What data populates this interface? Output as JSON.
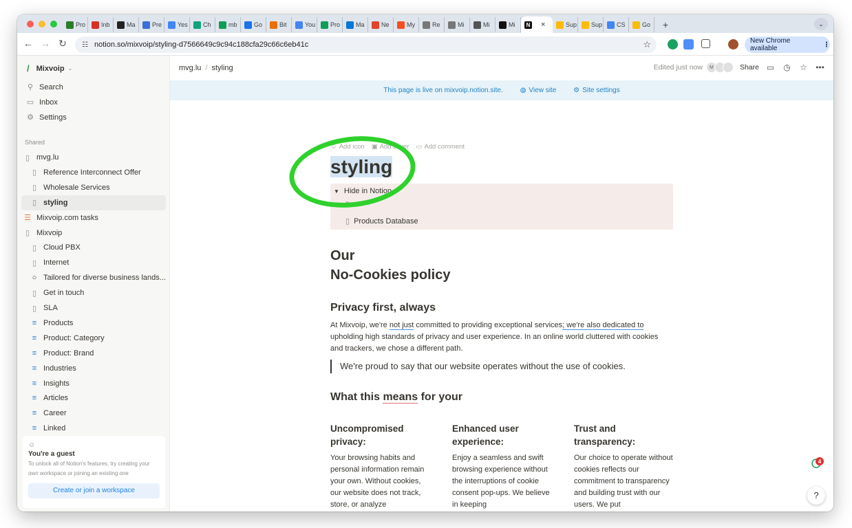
{
  "browser": {
    "tabs": [
      {
        "label": "Pro",
        "color": "#2a7d2a"
      },
      {
        "label": "Inb",
        "color": "#d93025"
      },
      {
        "label": "Ma",
        "color": "#222222"
      },
      {
        "label": "Pre",
        "color": "#3a6ed8"
      },
      {
        "label": "Yes",
        "color": "#4285f4"
      },
      {
        "label": "Ch",
        "color": "#10a37f"
      },
      {
        "label": "mb",
        "color": "#0f9d58"
      },
      {
        "label": "Go",
        "color": "#1a73e8"
      },
      {
        "label": "Bit",
        "color": "#e8710a"
      },
      {
        "label": "You",
        "color": "#4285f4"
      },
      {
        "label": "Pro",
        "color": "#0f9d58"
      },
      {
        "label": "Ma",
        "color": "#0078d4"
      },
      {
        "label": "Ne",
        "color": "#e24329"
      },
      {
        "label": "My",
        "color": "#f25022"
      },
      {
        "label": "Re",
        "color": "#777777"
      },
      {
        "label": "Mi",
        "color": "#777777"
      },
      {
        "label": "Mi",
        "color": "#555555"
      },
      {
        "label": "Mi",
        "color": "#111111"
      }
    ],
    "active_tab_close": "×",
    "tabs_after": [
      {
        "label": "Sup",
        "color": "#fbbc04"
      },
      {
        "label": "Sup",
        "color": "#fbbc04"
      },
      {
        "label": "CS",
        "color": "#4285f4"
      },
      {
        "label": "Go",
        "color": "#fbbc04"
      }
    ],
    "new_tab": "+",
    "url": "notion.so/mixvoip/styling-d7566649c9c94c188cfa29c66c6eb41c",
    "new_chrome": "New Chrome available"
  },
  "sidebar": {
    "workspace": "Mixvoip",
    "nav": [
      {
        "icon": "search-icon",
        "glyph": "⚲",
        "label": "Search"
      },
      {
        "icon": "inbox-icon",
        "glyph": "▭",
        "label": "Inbox"
      },
      {
        "icon": "gear-icon",
        "glyph": "⚙",
        "label": "Settings"
      }
    ],
    "shared_label": "Shared",
    "items": [
      {
        "label": "mvg.lu",
        "icon": "page-icon",
        "indent": false
      },
      {
        "label": "Reference Interconnect Offer",
        "icon": "page-icon",
        "indent": true
      },
      {
        "label": "Wholesale Services",
        "icon": "page-icon",
        "indent": true
      },
      {
        "label": "styling",
        "icon": "page-icon",
        "indent": true,
        "selected": true
      },
      {
        "label": "Mixvoip.com tasks",
        "icon": "checklist-icon",
        "indent": false
      },
      {
        "label": "Mixvoip",
        "icon": "page-icon",
        "indent": false
      },
      {
        "label": "Cloud PBX",
        "icon": "page-icon",
        "indent": true
      },
      {
        "label": "Internet",
        "icon": "page-icon",
        "indent": true
      },
      {
        "label": "Tailored for diverse business lands...",
        "icon": "circle-icon",
        "indent": true
      },
      {
        "label": "Get in touch",
        "icon": "page-icon",
        "indent": true
      },
      {
        "label": "SLA",
        "icon": "page-icon",
        "indent": true
      },
      {
        "label": "Products",
        "icon": "database-icon",
        "indent": true
      },
      {
        "label": "Product: Category",
        "icon": "database-icon",
        "indent": true
      },
      {
        "label": "Product: Brand",
        "icon": "database-icon",
        "indent": true
      },
      {
        "label": "Industries",
        "icon": "database-icon",
        "indent": true
      },
      {
        "label": "Insights",
        "icon": "database-icon",
        "indent": true
      },
      {
        "label": "Articles",
        "icon": "database-icon",
        "indent": true
      },
      {
        "label": "Career",
        "icon": "database-icon",
        "indent": true
      },
      {
        "label": "Linked",
        "icon": "database-icon",
        "indent": true
      }
    ],
    "guest": {
      "title": "You're a guest",
      "subtitle": "To unlock all of Notion's features, try creating your own workspace or joining an existing one",
      "button": "Create or join a workspace"
    }
  },
  "topbar": {
    "breadcrumb": [
      "mvg.lu",
      "/",
      "styling"
    ],
    "edited": "Edited just now",
    "avatar_initial": "M",
    "share": "Share"
  },
  "banner": {
    "text": "This page is live on mixvoip.notion.site.",
    "view_site": "View site",
    "site_settings": "Site settings"
  },
  "page": {
    "add_icon": "Add icon",
    "add_cover": "Add cover",
    "add_comment": "Add comment",
    "title": "styling",
    "toggle_label": "Hide in Notion",
    "toggle_hidden": "D...d",
    "products_db": "Products Database",
    "heading_line1": "Our",
    "heading_line2": "No-Cookies policy",
    "privacy_heading": "Privacy first, always",
    "para_part1": "At Mixvoip, we're ",
    "para_ul1": "not just",
    "para_part2": " committed to providing exceptional services",
    "para_ul2": "; we're also dedicated to",
    "para_part3": " upholding high standards of privacy and user experience. In an online world cluttered with cookies and trackers, we chose a different path.",
    "quote": "We're proud to say that our website operates without the use of cookies.",
    "means_pre": "What this ",
    "means_ul": "means",
    "means_post": " for your",
    "columns": [
      {
        "title": "Uncompromised privacy:",
        "body": "Your browsing habits and personal information remain your own. Without cookies, our website does not track, store, or analyze"
      },
      {
        "title": "Enhanced user experience:",
        "body": "Enjoy a seamless and swift browsing experience without the interruptions of cookie consent pop-ups. We believe in keeping"
      },
      {
        "title": "Trust and transparency:",
        "body": "Our choice to operate without cookies reflects our commitment to transparency and building trust with our users. We put"
      }
    ],
    "help": "?",
    "notification_count": "4"
  },
  "colors": {
    "annotation": "#2fd12c",
    "notion_blue": "#2383e2",
    "toggle_bg": "#f5ece9"
  }
}
